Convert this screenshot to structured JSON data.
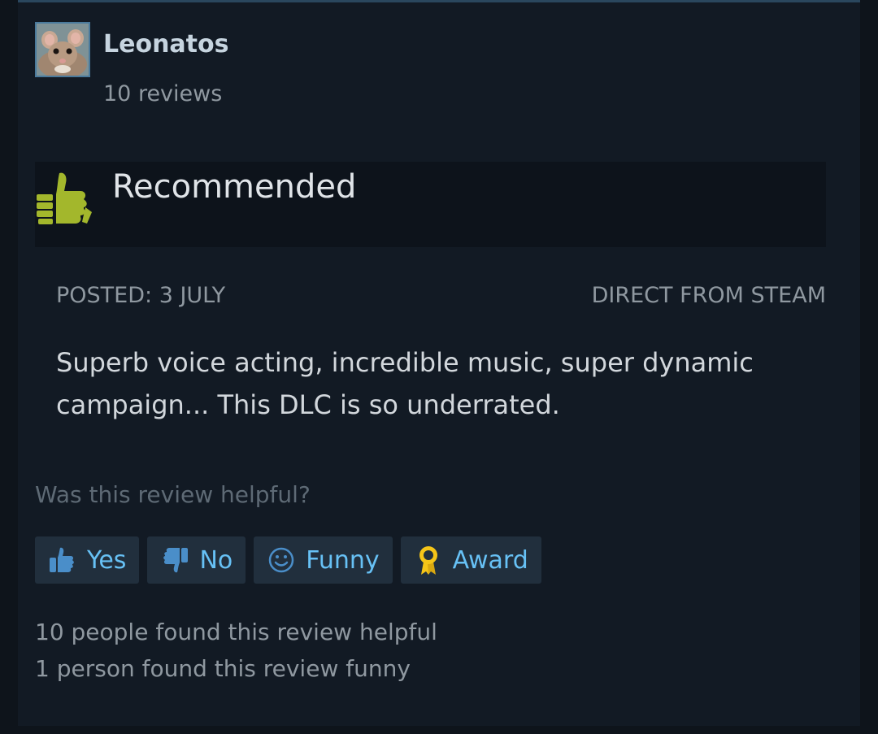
{
  "author": {
    "name": "Leonatos",
    "review_count": "10 reviews",
    "avatar_icon": "mouse-avatar"
  },
  "verdict": {
    "label": "Recommended",
    "icon": "thumbs-up-icon",
    "icon_color": "#a3b72c"
  },
  "meta": {
    "posted": "Posted: 3 July",
    "source": "Direct from Steam"
  },
  "body": "Superb voice acting, incredible music, super dynamic campaign... This DLC is so underrated.",
  "feedback": {
    "question": "Was this review helpful?",
    "buttons": [
      {
        "label": "Yes",
        "icon": "thumbs-up-icon"
      },
      {
        "label": "No",
        "icon": "thumbs-down-icon"
      },
      {
        "label": "Funny",
        "icon": "smiley-icon"
      },
      {
        "label": "Award",
        "icon": "award-icon"
      }
    ]
  },
  "stats": {
    "helpful": "10 people found this review helpful",
    "funny": "1 person found this review funny"
  },
  "colors": {
    "accent": "#67c1f5",
    "award": "#f5c518",
    "card_bg": "#121a24",
    "button_bg": "#212f3d"
  }
}
